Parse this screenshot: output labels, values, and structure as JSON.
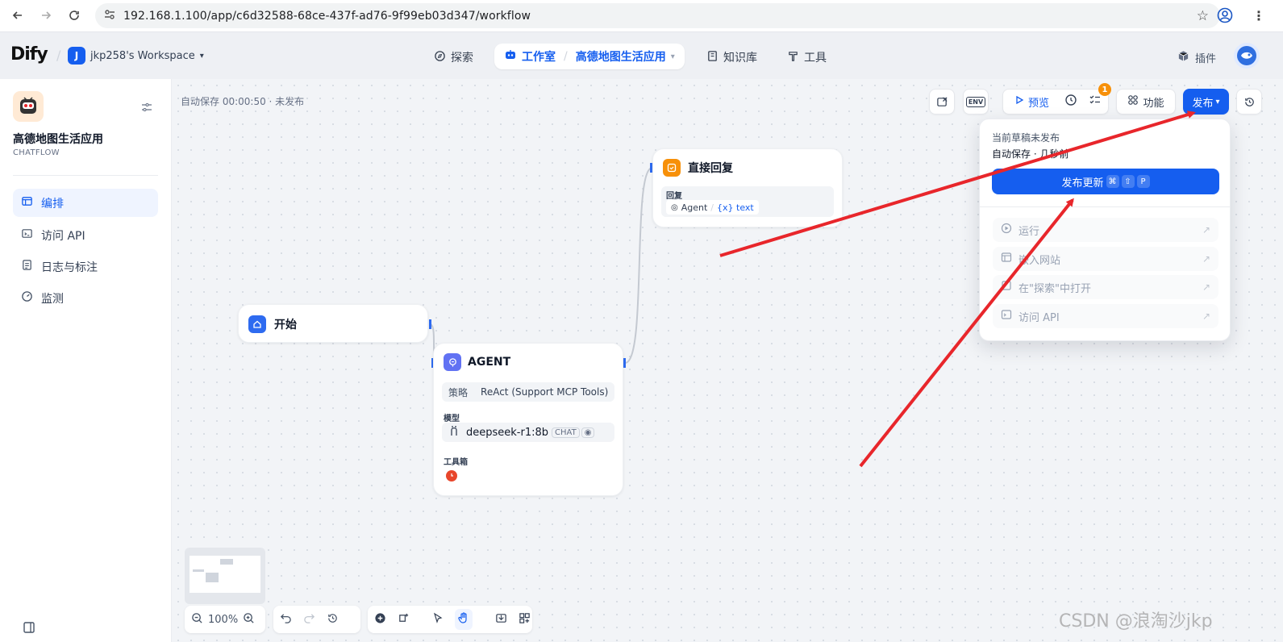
{
  "browser": {
    "url": "192.168.1.100/app/c6d32588-68ce-437f-ad76-9f99eb03d347/workflow"
  },
  "header": {
    "logo": "Dify",
    "workspace_initial": "J",
    "workspace_name": "jkp258's Workspace",
    "nav_explore": "探索",
    "nav_studio": "工作室",
    "nav_app": "高德地图生活应用",
    "nav_knowledge": "知识库",
    "nav_tools": "工具",
    "plugins": "插件"
  },
  "sidebar": {
    "app_name": "高德地图生活应用",
    "app_type": "CHATFLOW",
    "items": [
      {
        "label": "编排"
      },
      {
        "label": "访问 API"
      },
      {
        "label": "日志与标注"
      },
      {
        "label": "监测"
      }
    ]
  },
  "canvas": {
    "autosave": "自动保存 00:00:50 · 未发布",
    "toolbar": {
      "env": "ENV",
      "preview": "预览",
      "badge": "1",
      "features": "功能",
      "publish": "发布"
    },
    "nodes": {
      "start": {
        "title": "开始"
      },
      "agent": {
        "title": "AGENT",
        "strategy_label": "策略",
        "strategy_value": "ReAct (Support MCP Tools)",
        "model_label": "模型",
        "model_name": "deepseek-r1:8b",
        "model_tag": "CHAT",
        "toolbox_label": "工具箱"
      },
      "reply": {
        "title": "直接回复",
        "reply_label": "回复",
        "var_source": "Agent",
        "var_name": "{x} text"
      }
    },
    "publish_menu": {
      "status": "当前草稿未发布",
      "autosave": "自动保存 · 几秒前",
      "publish_update": "发布更新",
      "shortcut": [
        "⌘",
        "⇧",
        "P"
      ],
      "items": [
        {
          "label": "运行"
        },
        {
          "label": "嵌入网站"
        },
        {
          "label": "在\"探索\"中打开"
        },
        {
          "label": "访问 API"
        }
      ]
    },
    "zoom": "100%"
  },
  "watermark": "CSDN @浪淘沙jkp",
  "colors": {
    "primary": "#155eef",
    "annotation_arrow": "#e8262b"
  }
}
